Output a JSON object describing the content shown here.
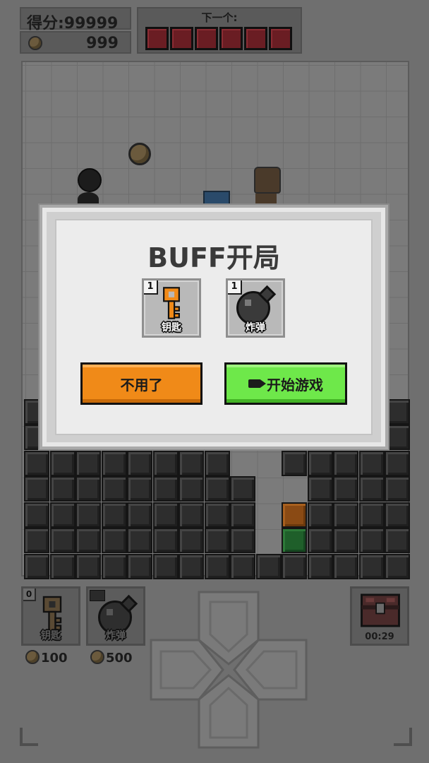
{
  "hud": {
    "score_label": "得分:99999",
    "coins": "999",
    "next_label": "下一个:",
    "next_count": 6
  },
  "dialog": {
    "title": "BUFF开局",
    "items": [
      {
        "name": "钥匙",
        "count": "1",
        "icon": "key-icon"
      },
      {
        "name": "炸弹",
        "count": "1",
        "icon": "bomb-icon"
      }
    ],
    "skip_label": "不用了",
    "start_label": "开始游戏"
  },
  "tools": [
    {
      "name": "钥匙",
      "count": "0",
      "price": "100",
      "icon": "key-icon"
    },
    {
      "name": "炸弹",
      "count": "",
      "price": "500",
      "icon": "bomb-icon"
    }
  ],
  "chest": {
    "timer": "00:29",
    "icon": "treasure-chest-icon"
  },
  "colors": {
    "block_red": "#6a1d23",
    "skip_button": "#f08a18",
    "start_button": "#6ee84a",
    "orange_block": "#8a4a14",
    "green_block": "#1f5f2a"
  }
}
